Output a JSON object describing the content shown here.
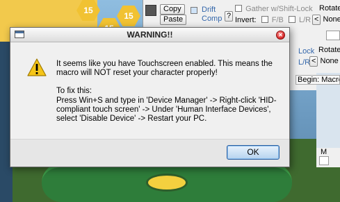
{
  "dialog": {
    "title": "WARNING!!",
    "close_icon": "close-icon",
    "warning_icon": "warning-triangle-icon",
    "message_line1": "It seems like you have Touchscreen enabled. This means the macro will NOT reset your character properly!",
    "message_line2": "To fix this:",
    "message_line3": "Press Win+S and type in 'Device Manager' -> Right-click 'HID-compliant touch screen' -> Under 'Human Interface Devices', select 'Disable Device' -> Restart your PC.",
    "ok_label": "OK"
  },
  "background_panel": {
    "copy_label": "Copy",
    "paste_label": "Paste",
    "drift_label": "Drift",
    "comp_label": "Comp",
    "help_label": "?",
    "gather_label": "Gather w/Shift-Lock",
    "rotate_label_1": "Rotate",
    "invert_label": "Invert:",
    "fb_label": "F/B",
    "lr_label": "L/R",
    "none_label": "None",
    "lock_label": "Lock",
    "lr_label_2": "L/R",
    "rotate_label_2": "Rotate",
    "none_label_2": "None",
    "begin_label": "Begin: Macro",
    "m_label": "M"
  },
  "game_scene": {
    "hex_1": "15",
    "hex_2": "15",
    "hex_3": "15"
  },
  "colors": {
    "accent": "#3366aa",
    "warning_yellow": "#f5c518",
    "ok_border": "#2c5fa0"
  }
}
